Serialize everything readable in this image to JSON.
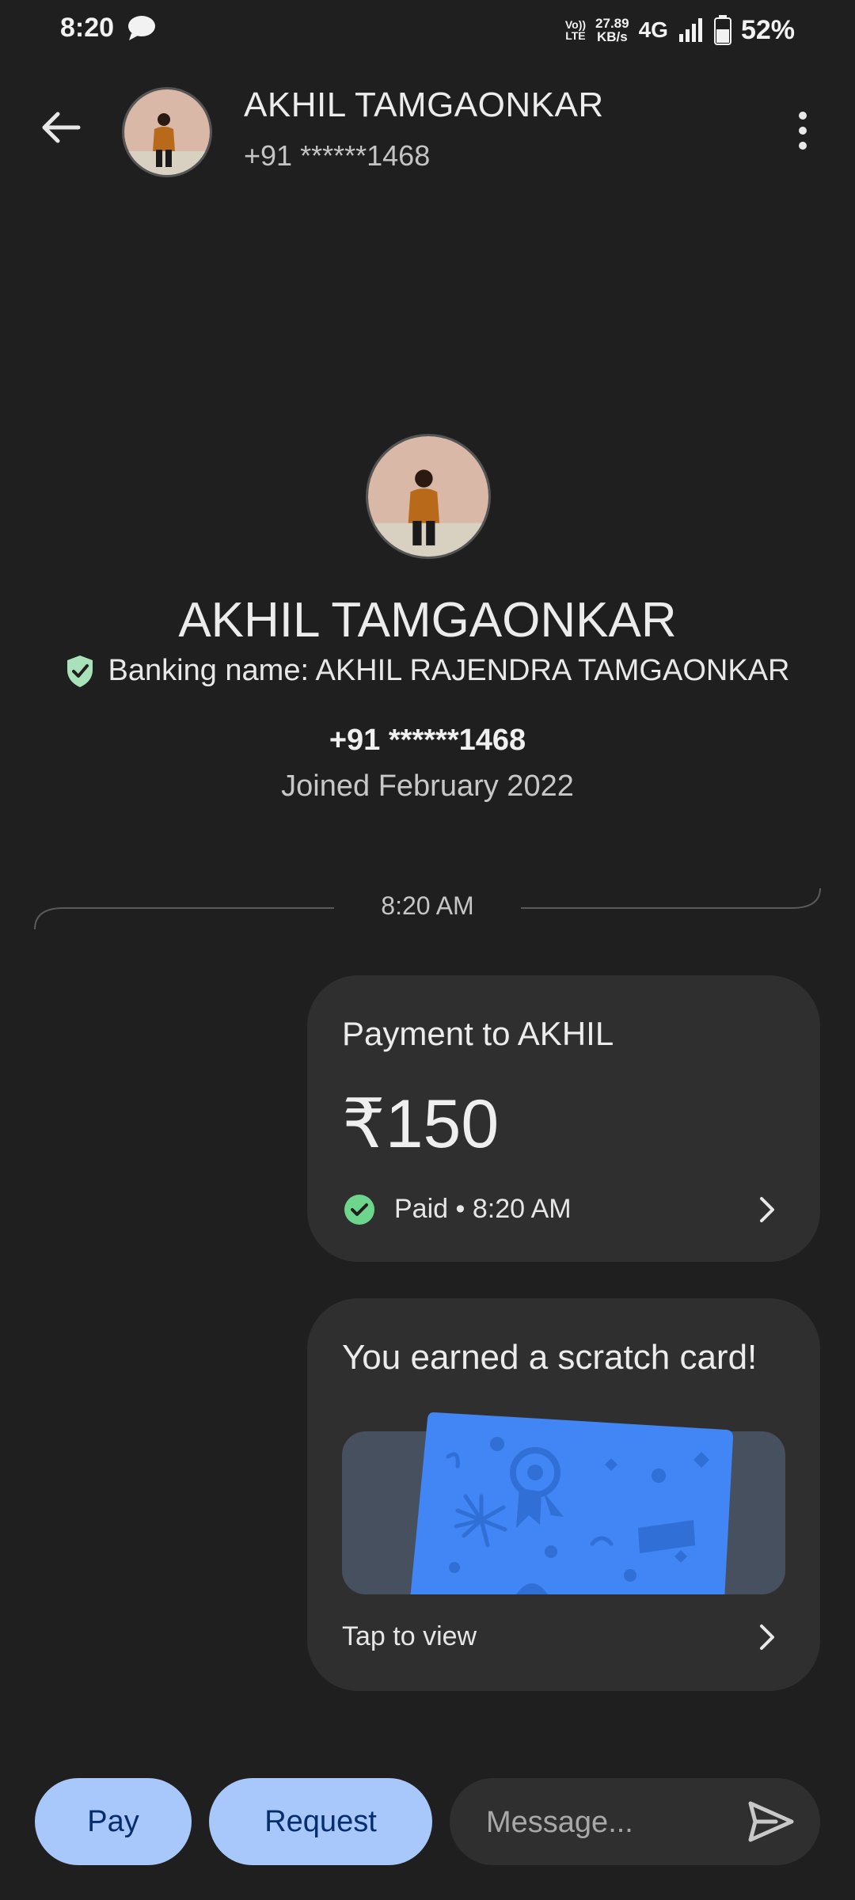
{
  "status_bar": {
    "time": "8:20",
    "volte_top": "Vo))",
    "volte_bottom": "LTE",
    "speed_value": "27.89",
    "speed_unit": "KB/s",
    "network": "4G",
    "battery": "52%"
  },
  "header": {
    "name": "AKHIL TAMGAONKAR",
    "phone": "+91 ******1468"
  },
  "profile": {
    "name": "AKHIL TAMGAONKAR",
    "banking_name": "Banking name: AKHIL RAJENDRA TAMGAONKAR",
    "phone": "+91 ******1468",
    "joined": "Joined February 2022"
  },
  "timeline": {
    "time": "8:20 AM"
  },
  "payment_card": {
    "title": "Payment to AKHIL",
    "amount": "₹150",
    "status": "Paid • 8:20 AM"
  },
  "scratch_card": {
    "title": "You earned a scratch card!",
    "action": "Tap to view"
  },
  "bottom_bar": {
    "pay_label": "Pay",
    "request_label": "Request",
    "message_placeholder": "Message..."
  },
  "colors": {
    "background": "#1f1f1f",
    "card": "#2f2f2f",
    "button": "#a8c7fa",
    "paid_green": "#6dd58c",
    "scratch_blue": "#4285f4"
  }
}
